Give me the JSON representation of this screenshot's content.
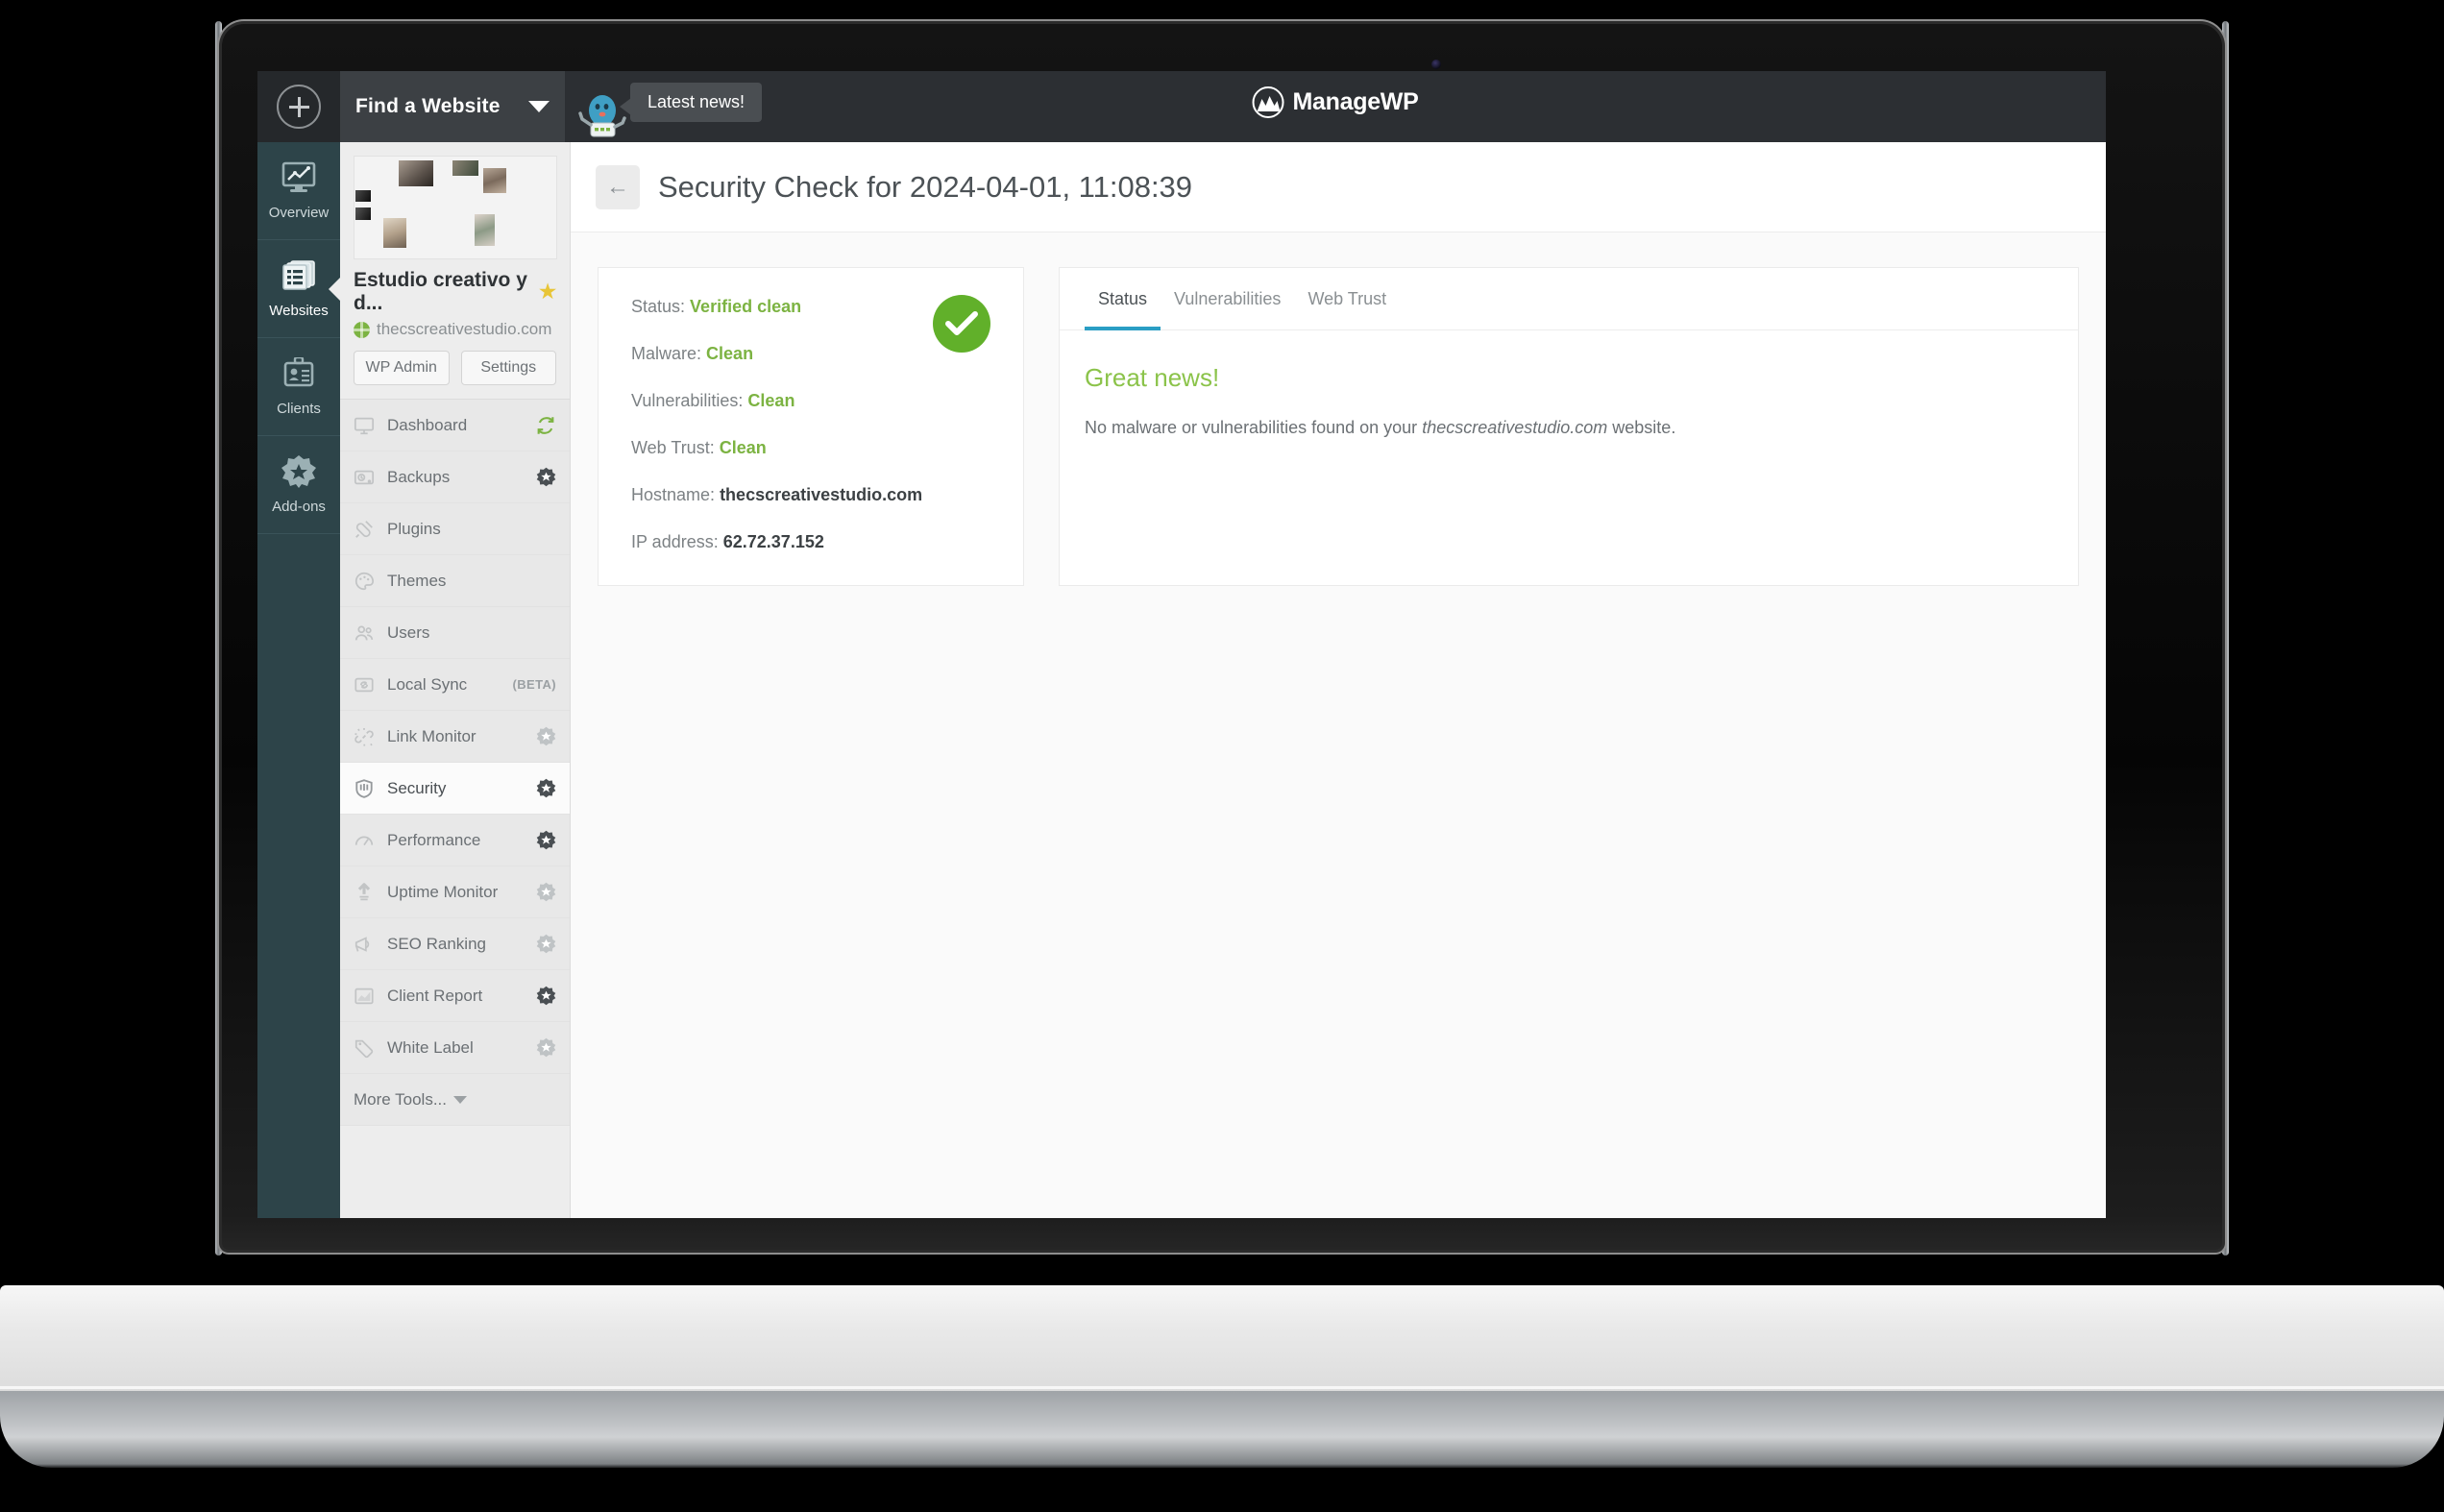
{
  "topbar": {
    "find_label": "Find a Website",
    "news_bubble": "Latest news!",
    "brand": "ManageWP"
  },
  "rail": {
    "items": [
      {
        "label": "Overview",
        "icon": "monitor-chart-icon",
        "active": false
      },
      {
        "label": "Websites",
        "icon": "stacked-pages-icon",
        "active": true
      },
      {
        "label": "Clients",
        "icon": "id-badge-icon",
        "active": false
      },
      {
        "label": "Add-ons",
        "icon": "star-burst-icon",
        "active": false
      }
    ]
  },
  "sidebar": {
    "site_title": "Estudio creativo y d...",
    "site_url": "thecscreativestudio.com",
    "favorite_icon": "star-icon",
    "globe_icon": "globe-icon",
    "buttons": {
      "wp_admin": "WP Admin",
      "settings": "Settings"
    },
    "menu": [
      {
        "label": "Dashboard",
        "icon": "monitor-icon",
        "active": false,
        "action": "refresh",
        "badge": ""
      },
      {
        "label": "Backups",
        "icon": "harddrive-icon",
        "active": false,
        "action": "gear-dark",
        "badge": ""
      },
      {
        "label": "Plugins",
        "icon": "plug-icon",
        "active": false,
        "action": "",
        "badge": ""
      },
      {
        "label": "Themes",
        "icon": "palette-icon",
        "active": false,
        "action": "",
        "badge": ""
      },
      {
        "label": "Users",
        "icon": "users-icon",
        "active": false,
        "action": "",
        "badge": ""
      },
      {
        "label": "Local Sync",
        "icon": "sync-folder-icon",
        "active": false,
        "action": "",
        "badge": "(BETA)"
      },
      {
        "label": "Link Monitor",
        "icon": "broken-link-icon",
        "active": false,
        "action": "gear-light",
        "badge": ""
      },
      {
        "label": "Security",
        "icon": "shield-icon",
        "active": true,
        "action": "gear-dark",
        "badge": ""
      },
      {
        "label": "Performance",
        "icon": "gauge-icon",
        "active": false,
        "action": "gear-dark",
        "badge": ""
      },
      {
        "label": "Uptime Monitor",
        "icon": "upload-arrow-icon",
        "active": false,
        "action": "gear-light",
        "badge": ""
      },
      {
        "label": "SEO Ranking",
        "icon": "megaphone-icon",
        "active": false,
        "action": "gear-light",
        "badge": ""
      },
      {
        "label": "Client Report",
        "icon": "area-chart-icon",
        "active": false,
        "action": "gear-dark",
        "badge": ""
      },
      {
        "label": "White Label",
        "icon": "tag-icon",
        "active": false,
        "action": "gear-light",
        "badge": ""
      }
    ],
    "more_tools": "More Tools..."
  },
  "page": {
    "back_icon": "arrow-left-icon",
    "title": "Security Check for 2024-04-01, 11:08:39"
  },
  "status_card": {
    "check_icon": "check-circle-icon",
    "rows": [
      {
        "label": "Status:",
        "value": "Verified clean",
        "state": "ok"
      },
      {
        "label": "Malware:",
        "value": "Clean",
        "state": "ok"
      },
      {
        "label": "Vulnerabilities:",
        "value": "Clean",
        "state": "ok"
      },
      {
        "label": "Web Trust:",
        "value": "Clean",
        "state": "ok"
      },
      {
        "label": "Hostname:",
        "value": "thecscreativestudio.com",
        "state": "plain"
      },
      {
        "label": "IP address:",
        "value": "62.72.37.152",
        "state": "plain"
      }
    ]
  },
  "panel": {
    "tabs": [
      {
        "label": "Status",
        "active": true
      },
      {
        "label": "Vulnerabilities",
        "active": false
      },
      {
        "label": "Web Trust",
        "active": false
      }
    ],
    "heading": "Great news!",
    "body_prefix": "No malware or vulnerabilities found on your ",
    "body_em": "thecscreativestudio.com",
    "body_suffix": " website."
  },
  "colors": {
    "accent_green": "#7cb342",
    "check_green": "#61b02a",
    "tab_blue": "#2a9ec4",
    "rail_teal": "#2d4449",
    "topbar_dark": "#2c2f33",
    "star_yellow": "#e8c537"
  }
}
